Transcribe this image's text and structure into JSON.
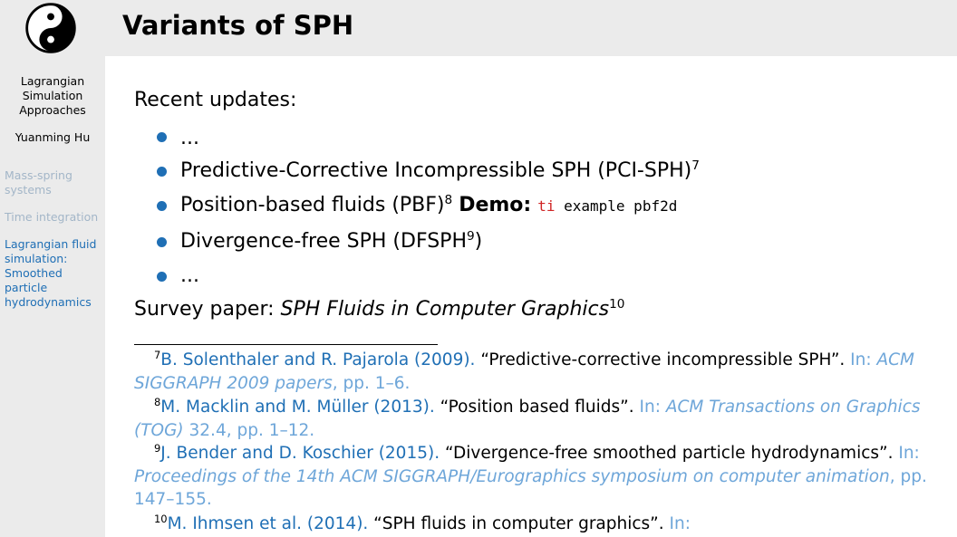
{
  "sidebar": {
    "title_lines": [
      "Lagrangian",
      "Simulation",
      "Approaches"
    ],
    "author": "Yuanming Hu",
    "nav": [
      {
        "lines": [
          "Mass-spring",
          "systems"
        ],
        "current": false
      },
      {
        "lines": [
          "Time integration"
        ],
        "current": false
      },
      {
        "lines": [
          "Lagrangian fluid",
          "simulation:",
          "Smoothed",
          "particle",
          "hydrodynamics"
        ],
        "current": true
      }
    ],
    "logo_icon": "yin-yang-icon"
  },
  "frame": {
    "title": "Variants of SPH"
  },
  "content": {
    "intro": "Recent updates:",
    "items": [
      {
        "text": "..."
      },
      {
        "text": "Predictive-Corrective Incompressible SPH (PCI-SPH)",
        "sup": "7"
      },
      {
        "text": "Position-based fluids (PBF)",
        "sup": "8",
        "demo_label": "Demo:",
        "demo_cmd_red": "ti",
        "demo_cmd": " example pbf2d"
      },
      {
        "text_pre": "Divergence-free SPH (DFSPH",
        "sup": "9",
        "text_post": ")"
      },
      {
        "text": "..."
      }
    ],
    "survey_prefix": "Survey paper: ",
    "survey_title": "SPH Fluids in Computer Graphics",
    "survey_sup": "10"
  },
  "footnotes": [
    {
      "num": "7",
      "authors": "B. Solenthaler and R. Pajarola (2009).",
      "title": " “Predictive-corrective incompressible SPH”.",
      "in": " In: ",
      "venue": "ACM SIGGRAPH 2009 papers",
      "pages": ", pp. 1–6."
    },
    {
      "num": "8",
      "authors": "M. Macklin and M. Müller (2013).",
      "title": " “Position based fluids”.",
      "in": " In: ",
      "venue": "ACM Transactions on Graphics (TOG)",
      "pages": " 32.4, pp. 1–12."
    },
    {
      "num": "9",
      "authors": "J. Bender and D. Koschier (2015).",
      "title": " “Divergence-free smoothed particle hydrodynamics”.",
      "in": " In: ",
      "venue": "Proceedings of the 14th ACM SIGGRAPH/Eurographics symposium on computer animation",
      "pages": ", pp. 147–155."
    },
    {
      "num": "10",
      "authors": "M. Ihmsen et al. (2014).",
      "title": " “SPH fluids in computer graphics”.",
      "in": " In:",
      "venue": "",
      "pages": ""
    }
  ],
  "colors": {
    "accent": "#1f6fb5",
    "link_light": "#6ea6d9",
    "nav_inactive": "#a3b6c8",
    "code_red": "#d02626",
    "panel_bg": "#ebebeb"
  }
}
